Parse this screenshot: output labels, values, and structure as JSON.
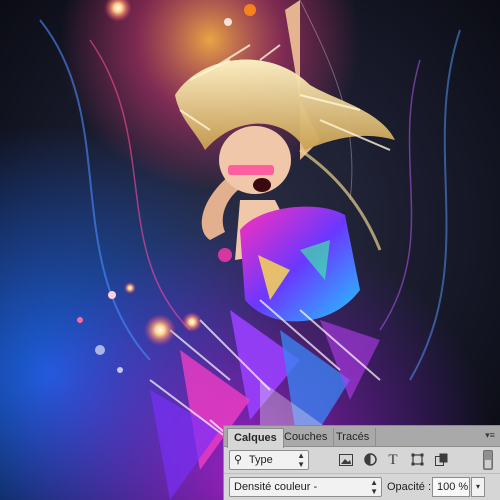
{
  "artwork": {
    "description_colors": {
      "accent_blue": "#2a7dff",
      "accent_magenta": "#e020c8",
      "accent_orange": "#ff8a1a",
      "hair": "#e8d38a",
      "skin": "#f0c7a8"
    }
  },
  "layers_panel": {
    "tabs": [
      {
        "label": "Calques",
        "active": true
      },
      {
        "label": "Couches",
        "active": false
      },
      {
        "label": "Tracés",
        "active": false
      }
    ],
    "menu_icon": "panel-menu-icon",
    "filter": {
      "label": "Type",
      "icon": "search-icon"
    },
    "filter_icons": [
      "image-filter-icon",
      "adjustment-filter-icon",
      "text-filter-icon",
      "shape-filter-icon",
      "smart-object-filter-icon"
    ],
    "text_icon_glyph": "T",
    "blend_mode": "Densité couleur -",
    "opacity_label": "Opacité :",
    "opacity_value": "100 %"
  }
}
